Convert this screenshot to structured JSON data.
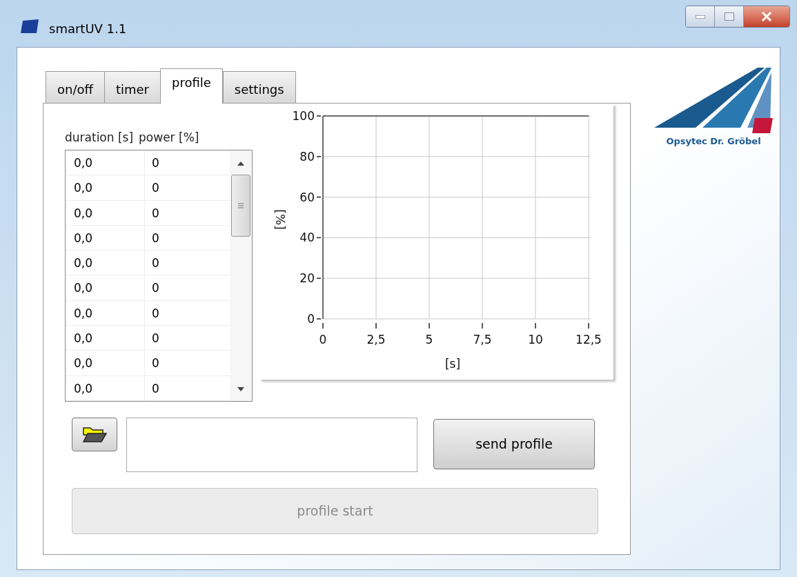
{
  "window": {
    "title": "smartUV 1.1"
  },
  "tabs": [
    {
      "label": "on/off",
      "selected": false
    },
    {
      "label": "timer",
      "selected": false
    },
    {
      "label": "profile",
      "selected": true
    },
    {
      "label": "settings",
      "selected": false
    }
  ],
  "table": {
    "columns": [
      "duration [s]",
      "power [%]"
    ],
    "rows": [
      [
        "0,0",
        "0"
      ],
      [
        "0,0",
        "0"
      ],
      [
        "0,0",
        "0"
      ],
      [
        "0,0",
        "0"
      ],
      [
        "0,0",
        "0"
      ],
      [
        "0,0",
        "0"
      ],
      [
        "0,0",
        "0"
      ],
      [
        "0,0",
        "0"
      ],
      [
        "0,0",
        "0"
      ],
      [
        "0,0",
        "0"
      ]
    ]
  },
  "chart": {
    "chart_data": {
      "type": "line",
      "grid": true,
      "xlabel": "[s]",
      "ylabel": "[%]",
      "xlim": [
        0,
        12.5
      ],
      "ylim": [
        0,
        100
      ],
      "xticks": [
        {
          "value": 0,
          "label": "0"
        },
        {
          "value": 2.5,
          "label": "2,5"
        },
        {
          "value": 5,
          "label": "5"
        },
        {
          "value": 7.5,
          "label": "7,5"
        },
        {
          "value": 10,
          "label": "10"
        },
        {
          "value": 12.5,
          "label": "12,5"
        }
      ],
      "yticks": [
        {
          "value": 0,
          "label": "0"
        },
        {
          "value": 20,
          "label": "20"
        },
        {
          "value": 40,
          "label": "40"
        },
        {
          "value": 60,
          "label": "60"
        },
        {
          "value": 80,
          "label": "80"
        },
        {
          "value": 100,
          "label": "100"
        }
      ]
    }
  },
  "buttons": [
    {
      "label": "send profile",
      "disabled": false
    },
    {
      "label": "profile start",
      "disabled": true
    }
  ],
  "logo": {
    "text": "Opsytec Dr. Gröbel"
  }
}
